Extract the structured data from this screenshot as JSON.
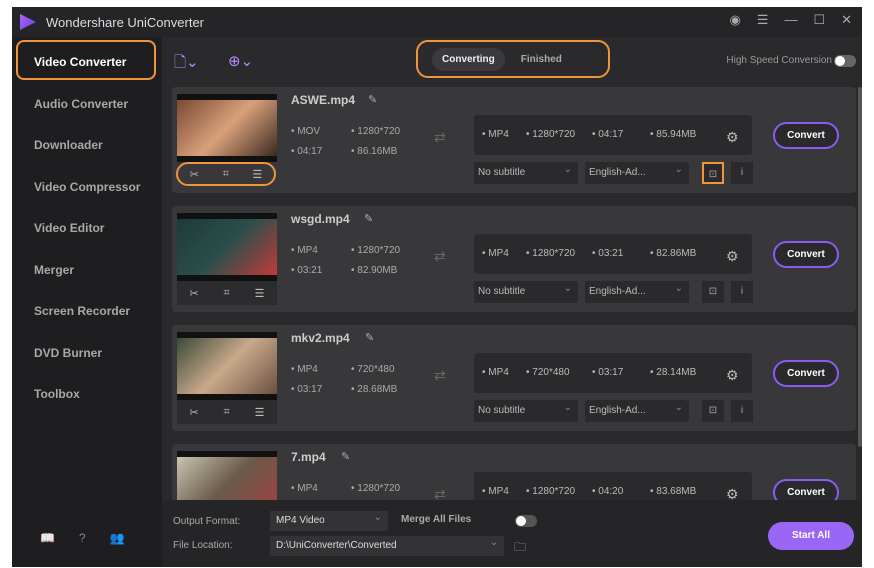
{
  "app": {
    "title": "Wondershare UniConverter"
  },
  "sidebar": {
    "items": [
      "Video Converter",
      "Audio Converter",
      "Downloader",
      "Video Compressor",
      "Video Editor",
      "Merger",
      "Screen Recorder",
      "DVD Burner",
      "Toolbox"
    ]
  },
  "toolbar": {
    "tabs": [
      "Converting",
      "Finished"
    ],
    "high_speed": "High Speed Conversion"
  },
  "files": [
    {
      "name": "ASWE.mp4",
      "src_format": "MOV",
      "src_res": "1280*720",
      "src_dur": "04:17",
      "src_size": "86.16MB",
      "out_format": "MP4",
      "out_res": "1280*720",
      "out_dur": "04:17",
      "out_size": "85.94MB",
      "subtitle": "No subtitle",
      "audio": "English-Ad...",
      "convert": "Convert"
    },
    {
      "name": "wsgd.mp4",
      "src_format": "MP4",
      "src_res": "1280*720",
      "src_dur": "03:21",
      "src_size": "82.90MB",
      "out_format": "MP4",
      "out_res": "1280*720",
      "out_dur": "03:21",
      "out_size": "82.86MB",
      "subtitle": "No subtitle",
      "audio": "English-Ad...",
      "convert": "Convert"
    },
    {
      "name": "mkv2.mp4",
      "src_format": "MP4",
      "src_res": "720*480",
      "src_dur": "03:17",
      "src_size": "28.68MB",
      "out_format": "MP4",
      "out_res": "720*480",
      "out_dur": "03:17",
      "out_size": "28.14MB",
      "subtitle": "No subtitle",
      "audio": "English-Ad...",
      "convert": "Convert"
    },
    {
      "name": "7.mp4",
      "src_format": "MP4",
      "src_res": "1280*720",
      "src_dur": "",
      "src_size": "",
      "out_format": "MP4",
      "out_res": "1280*720",
      "out_dur": "04:20",
      "out_size": "83.68MB",
      "subtitle": "",
      "audio": "",
      "convert": "Convert"
    }
  ],
  "bottom": {
    "output_format_label": "Output Format:",
    "output_format": "MP4 Video",
    "merge_label": "Merge All Files",
    "file_location_label": "File Location:",
    "file_location": "D:\\UniConverter\\Converted",
    "start_all": "Start All"
  },
  "colors": {
    "accent": "#8a5cf0",
    "highlight": "#f0953a"
  }
}
